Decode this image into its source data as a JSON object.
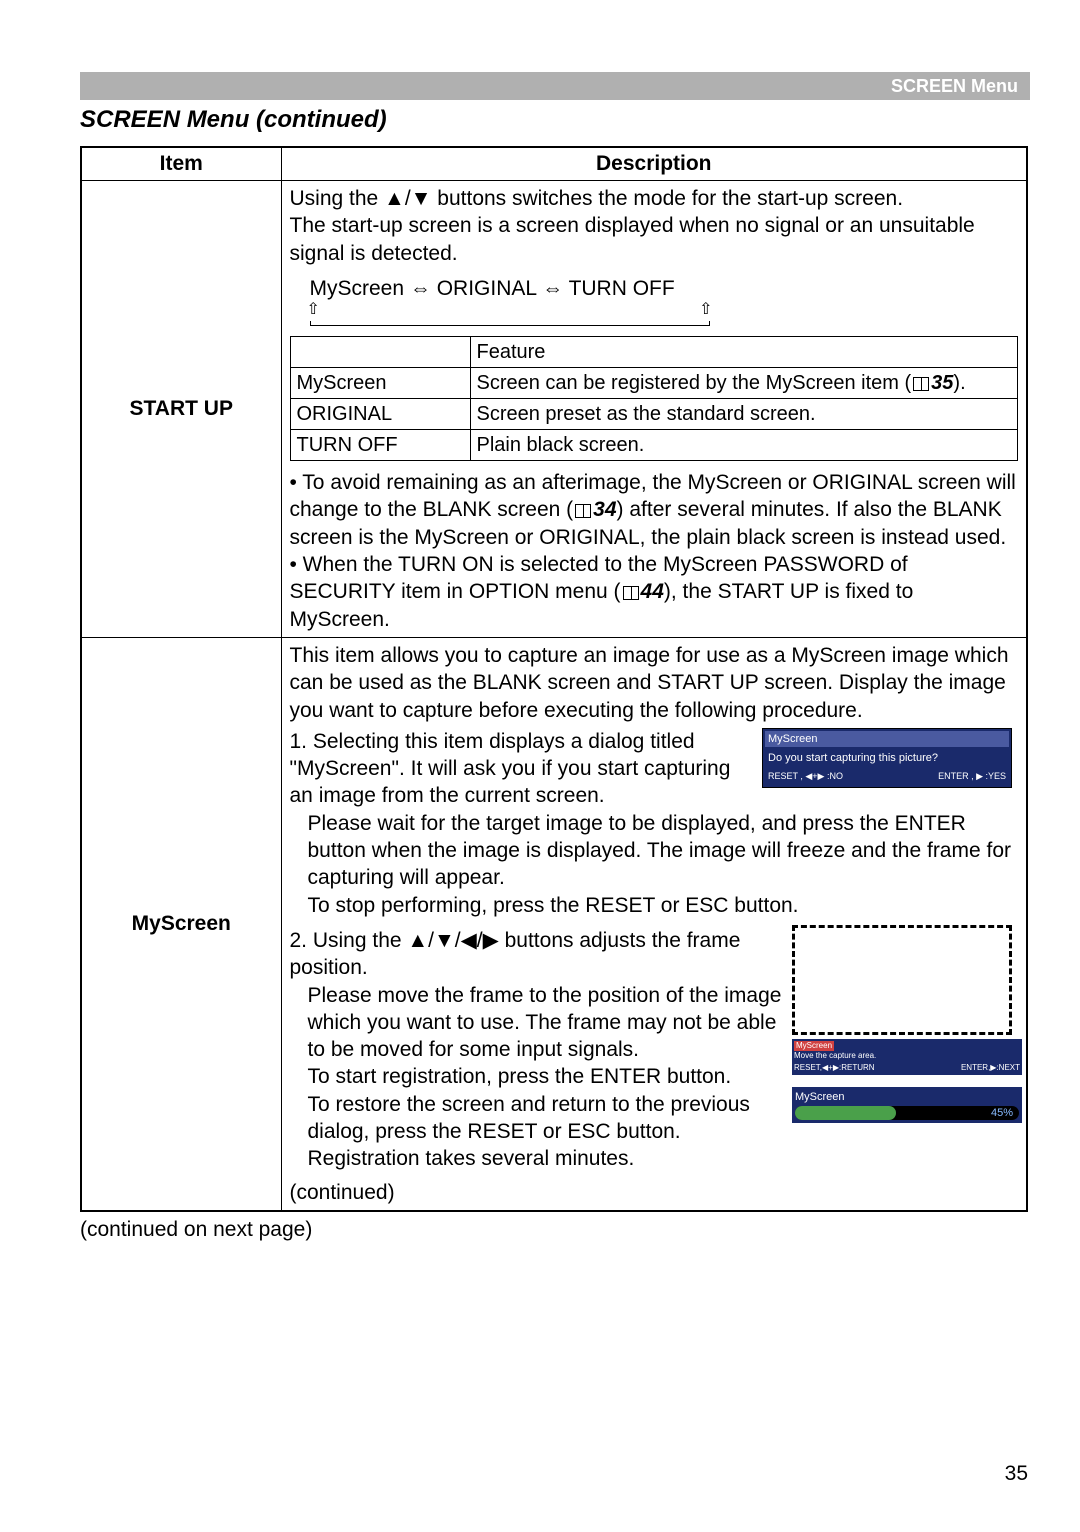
{
  "header": {
    "label": "SCREEN Menu"
  },
  "section_title": "SCREEN Menu (continued)",
  "table_headers": {
    "item": "Item",
    "desc": "Description"
  },
  "rows": {
    "startup": {
      "name": "START UP",
      "intro1": "Using the ▲/▼ buttons switches the mode for the start-up screen.",
      "intro2": "The start-up screen is a screen displayed when no signal or an unsuitable signal is detected.",
      "cycle": "MyScreen ⇔ ORIGINAL ⇔ TURN OFF",
      "feature_hdr": "Feature",
      "opts": {
        "myscreen_name": "MyScreen",
        "myscreen_desc_a": "Screen can be registered by the MyScreen item (",
        "myscreen_desc_ref": "35",
        "myscreen_desc_b": ").",
        "original_name": "ORIGINAL",
        "original_desc": "Screen preset as the standard screen.",
        "turnoff_name": "TURN OFF",
        "turnoff_desc": "Plain black screen."
      },
      "bullet1a": "• To avoid remaining as an afterimage, the MyScreen or ORIGINAL screen will change to the BLANK screen (",
      "bullet1ref": "34",
      "bullet1b": ") after several minutes. If also the BLANK screen is the MyScreen or ORIGINAL, the plain black screen is instead used.",
      "bullet2a": "• When the TURN ON is selected to the MyScreen PASSWORD of SECURITY item in OPTION menu (",
      "bullet2ref": "44",
      "bullet2b": "), the START UP is fixed to MyScreen."
    },
    "myscreen": {
      "name": "MyScreen",
      "intro": "This item allows you to capture an image for use as a MyScreen image which can be used as the BLANK screen and START UP screen. Display the image you want to capture before executing the following procedure.",
      "step1a": "1. Selecting this item displays a dialog titled \"MyScreen\". It will ask you if you start capturing an image from the current screen.",
      "step1b": "Please wait for the target image to be displayed, and press the ENTER button when the image is displayed. The image will freeze and the frame for capturing will appear.",
      "step1c": "To stop performing, press the RESET or ESC button.",
      "step2a": "2. Using the ▲/▼/◀/▶ buttons adjusts the frame position.",
      "step2b": "Please move the frame to the position of the image which you want to use. The frame may not be able to be moved for some input signals.",
      "step2c": "To start registration, press the ENTER button.",
      "step2d": "To restore the screen and return to the previous dialog, press the RESET or ESC button.",
      "step2e": "Registration takes several minutes.",
      "continued": "(continued)",
      "dialog1": {
        "title": "MyScreen",
        "body": "Do you start capturing this picture?",
        "no_btn": "RESET , ◀+▶ :NO",
        "yes_btn": "ENTER , ▶ :YES"
      },
      "status_bar": {
        "title": "MyScreen",
        "line": "Move the capture area.",
        "left_key": "RESET,◀+▶:RETURN",
        "right_key": "ENTER,▶:NEXT"
      },
      "progress": {
        "title": "MyScreen",
        "pct": "45%"
      }
    }
  },
  "continued_footer": "(continued on next page)",
  "page_number": "35"
}
